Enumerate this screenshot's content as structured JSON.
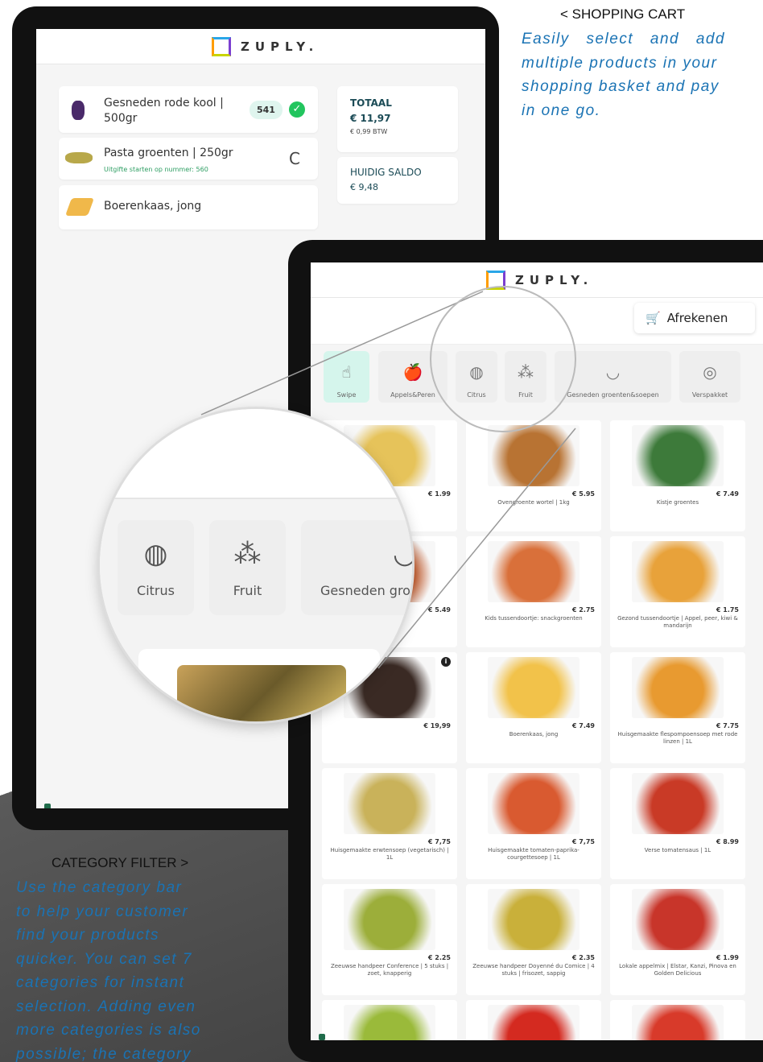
{
  "annotation_cart": {
    "title": "< SHOPPING CART",
    "lines": [
      "Easily select and add",
      "multiple products in your",
      "shopping basket and pay",
      "in one go."
    ]
  },
  "annotation_category": {
    "title": "CATEGORY FILTER >",
    "lines": [
      "Use the category bar",
      "to help your customer",
      "find your products",
      "quicker. You can set 7",
      "categories for instant",
      "selection. Adding even",
      "more categories is also",
      "possible; the category"
    ]
  },
  "brand": "ZUPLY.",
  "cart": {
    "items": [
      {
        "name": "Gesneden rode kool | 500gr",
        "badge": "541",
        "status": "done"
      },
      {
        "name": "Pasta groenten | 250gr",
        "note": "Uitgifte starten op nummer: 560",
        "status": "C"
      },
      {
        "name": "Boerenkaas, jong"
      }
    ],
    "total_label": "TOTAAL",
    "total_value": "€ 11,97",
    "btw": "€ 0,99 BTW",
    "balance_label": "HUIDIG SALDO",
    "balance_value": "€ 9,48"
  },
  "shop": {
    "checkout_label": "Afrekenen",
    "categories": [
      {
        "label": "Swipe",
        "icon": "swipe-icon",
        "glyph": "☝"
      },
      {
        "label": "Appels&Peren",
        "icon": "apple-icon",
        "glyph": "🍎"
      },
      {
        "label": "Citrus",
        "icon": "citrus-icon",
        "glyph": "◍"
      },
      {
        "label": "Fruit",
        "icon": "grapes-icon",
        "glyph": "⁂"
      },
      {
        "label": "Gesneden groenten&soepen",
        "icon": "bowl-icon",
        "glyph": "◡"
      },
      {
        "label": "Verspakket",
        "icon": "plate-icon",
        "glyph": "◎"
      }
    ],
    "products": [
      {
        "name": "| 500gr",
        "price": "€ 1.99",
        "color": "#e6c35a"
      },
      {
        "name": "Ovengroente wortel | 1kg",
        "price": "€ 5.95",
        "color": "#b87333"
      },
      {
        "name": "Kistje groentes",
        "price": "€ 7.49",
        "color": "#3d7a3a"
      },
      {
        "name": "ntjes",
        "price": "€ 5.49",
        "color": "#c8663a"
      },
      {
        "name": "Kids tussendoortje: snackgroenten",
        "price": "€ 2.75",
        "color": "#d9703a"
      },
      {
        "name": "Gezond tussendoortje | Appel, peer, kiwi & mandarijn",
        "price": "€ 1.75",
        "color": "#e8a23a"
      },
      {
        "name": "",
        "price": "€ 19,99",
        "color": "#3a2a24"
      },
      {
        "name": "Boerenkaas, jong",
        "price": "€ 7.49",
        "color": "#f2c24a"
      },
      {
        "name": "Huisgemaakte flespompoensoep met rode linzen | 1L",
        "price": "€ 7.75",
        "color": "#e89a30"
      },
      {
        "name": "Huisgemaakte erwtensoep (vegetarisch) | 1L",
        "price": "€ 7,75",
        "color": "#c9b25a"
      },
      {
        "name": "Huisgemaakte tomaten-paprika-courgettesoep | 1L",
        "price": "€ 7,75",
        "color": "#d95a30"
      },
      {
        "name": "Verse tomatensaus | 1L",
        "price": "€ 8.99",
        "color": "#c93a26"
      },
      {
        "name": "Zeeuwse handpeer Conference | 5 stuks | zoet, knapperig",
        "price": "€ 2.25",
        "color": "#9cae3a"
      },
      {
        "name": "Zeeuwse handpeer Doyenné du Comice | 4 stuks | frisozet, sappig",
        "price": "€ 2.35",
        "color": "#c9b03a"
      },
      {
        "name": "Lokale appelmix | Elstar, Kanzi, Pinova en Golden Delicious",
        "price": "€ 1.99",
        "color": "#c8352a"
      },
      {
        "name": "",
        "price": "",
        "color": "#9aba3a"
      },
      {
        "name": "",
        "price": "",
        "color": "#d42a20"
      },
      {
        "name": "",
        "price": "",
        "color": "#d83a2a"
      }
    ]
  },
  "zoom": {
    "categories": [
      {
        "label": "Citrus",
        "icon": "citrus-icon",
        "glyph": "◍"
      },
      {
        "label": "Fruit",
        "icon": "grapes-icon",
        "glyph": "⁂"
      },
      {
        "label": "Gesneden gro",
        "icon": "bowl-icon",
        "glyph": "◡"
      }
    ]
  }
}
